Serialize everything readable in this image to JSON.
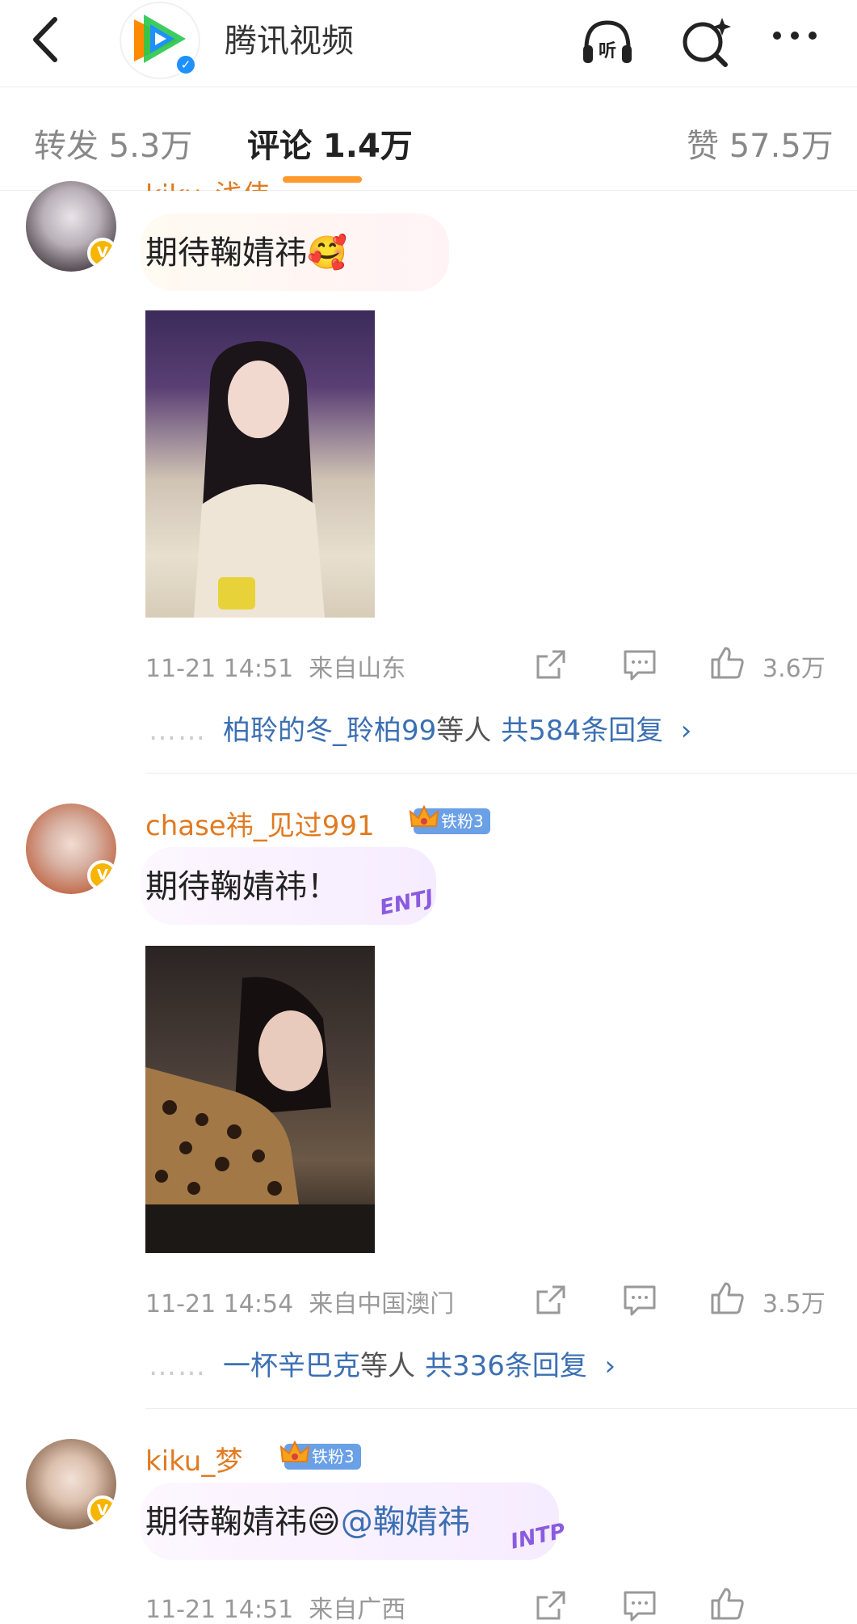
{
  "header": {
    "title": "腾讯视频",
    "brand_colors": {
      "play_orange": "#ff8a00",
      "play_green": "#28c84e",
      "play_blue": "#1e90ff",
      "play_purple": "#7b4ff0"
    }
  },
  "tabs": {
    "repost": "转发 5.3万",
    "comments": "评论 1.4万",
    "likes": "赞 57.5万"
  },
  "comments": [
    {
      "username": "kiku_浅伟",
      "text": "期待鞠婧祎",
      "emoji": "🥰",
      "time": "11-21 14:51",
      "location": "来自山东",
      "likes": "3.6万",
      "reply_names": "柏聆的冬_聆柏99",
      "reply_suffix": "等人",
      "reply_total": "共584条回复",
      "reply_arrow": "›"
    },
    {
      "username": "chase祎_见过991",
      "fan_badge": "铁粉3",
      "text": "期待鞠婧祎！",
      "tag": "ENTJ",
      "time": "11-21 14:54",
      "location": "来自中国澳门",
      "likes": "3.5万",
      "reply_names": "一杯辛巴克",
      "reply_suffix": "等人",
      "reply_total": "共336条回复",
      "reply_arrow": "›"
    },
    {
      "username": "kiku_梦",
      "fan_badge": "铁粉3",
      "text": "期待鞠婧祎",
      "emoji": "😄",
      "mention": "@鞠婧祎",
      "tag": "INTP",
      "time": "11-21 14:51",
      "location": "来自广西"
    }
  ],
  "reply_dots": "……"
}
